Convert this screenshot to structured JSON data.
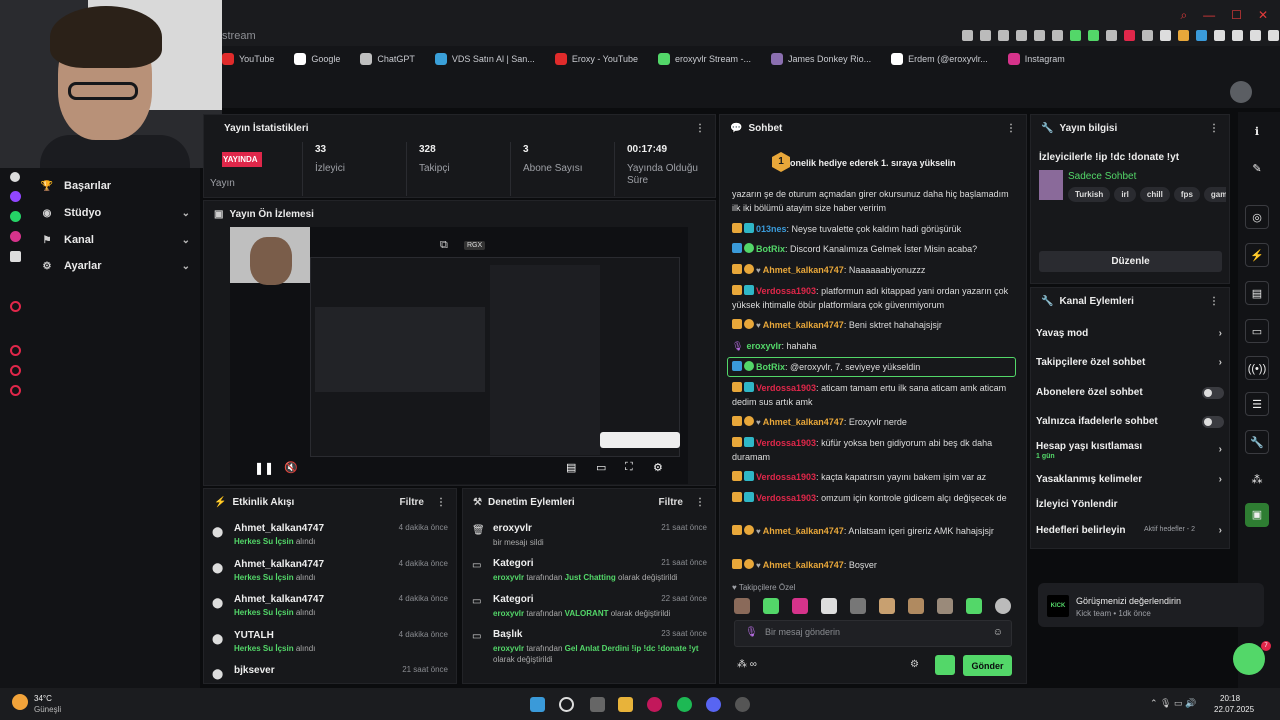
{
  "browser": {
    "tab_title": "stream",
    "bookmarks": [
      {
        "label": "YouTube",
        "color": "#e02b2b"
      },
      {
        "label": "Google",
        "color": "#ffffff"
      },
      {
        "label": "ChatGPT",
        "color": "#bfbfbf"
      },
      {
        "label": "VDS Satın Al | San...",
        "color": "#3aa0d9"
      },
      {
        "label": "Eroxy - YouTube",
        "color": "#e02b2b"
      },
      {
        "label": "eroxyvlr Stream -...",
        "color": "#53d769"
      },
      {
        "label": "James Donkey Rio...",
        "color": "#8b6fb0"
      },
      {
        "label": "Erdem (@eroxyvlr...",
        "color": "#ffffff"
      },
      {
        "label": "Instagram",
        "color": "#d6338b"
      }
    ]
  },
  "left_nav": {
    "items": [
      {
        "label": "Başarılar",
        "icon": "trophy-icon",
        "has_chevron": false
      },
      {
        "label": "Stüdyo",
        "icon": "studio-icon",
        "has_chevron": true
      },
      {
        "label": "Kanal",
        "icon": "channel-icon",
        "has_chevron": true
      },
      {
        "label": "Ayarlar",
        "icon": "gear-icon",
        "has_chevron": true
      }
    ]
  },
  "stats": {
    "title": "Yayın İstatistikleri",
    "live_badge": "YAYINDA",
    "live_label": "Yayın",
    "viewers": {
      "value": "33",
      "label": "İzleyici"
    },
    "followers": {
      "value": "328",
      "label": "Takipçi"
    },
    "subs": {
      "value": "3",
      "label": "Abone Sayısı"
    },
    "uptime": {
      "value": "00:17:49",
      "label": "Yayında Olduğu Süre"
    }
  },
  "preview": {
    "title": "Yayın Ön İzlemesi",
    "badge": "RGX"
  },
  "activity": {
    "title": "Etkinlik Akışı",
    "filter": "Filtre",
    "items": [
      {
        "name": "Ahmet_kalkan4747",
        "sub": "Herkes Su İçsin",
        "suffix": "alındı",
        "time": "4 dakika önce"
      },
      {
        "name": "Ahmet_kalkan4747",
        "sub": "Herkes Su İçsin",
        "suffix": "alındı",
        "time": "4 dakika önce"
      },
      {
        "name": "Ahmet_kalkan4747",
        "sub": "Herkes Su İçsin",
        "suffix": "alındı",
        "time": "4 dakika önce"
      },
      {
        "name": "YUTALH",
        "sub": "Herkes Su İçsin",
        "suffix": "alındı",
        "time": "4 dakika önce"
      },
      {
        "name": "bjksever",
        "sub": "",
        "suffix": "",
        "time": "21 saat önce"
      }
    ]
  },
  "moderation": {
    "title": "Denetim Eylemleri",
    "filter": "Filtre",
    "items": [
      {
        "title": "eroxyvlr",
        "line": "bir mesajı sildi",
        "time": "21 saat önce"
      },
      {
        "title": "Kategori",
        "user": "eroxyvlr",
        "pre": "tarafından",
        "target": "Just Chatting",
        "post": "olarak değiştirildi",
        "time": "21 saat önce"
      },
      {
        "title": "Kategori",
        "user": "eroxyvlr",
        "pre": "tarafından",
        "target": "VALORANT",
        "post": "olarak değiştirildi",
        "time": "22 saat önce"
      },
      {
        "title": "Başlık",
        "user": "eroxyvlr",
        "pre": "tarafından",
        "target": "Gel Anlat Derdini !ip !dc !donate !yt",
        "post": "olarak değiştirildi",
        "time": "23 saat önce"
      }
    ]
  },
  "chat": {
    "title": "Sohbet",
    "pinned": "1 abonelik hediye ederek 1. sıraya yükselin",
    "pinned_rank": "1",
    "partial_top": "yazarın şe de oturum açmadan girer okursunuz daha hiç başlamadım ilk iki bölümü atayim size haber veririm",
    "messages": [
      {
        "user": "013nes",
        "color": "#3a9ad9",
        "text": "Neyse tuvalette çok kaldım hadi görüşürük",
        "badges": "sub"
      },
      {
        "user": "BotRix",
        "color": "#53d769",
        "text": "Discord Kanalımıza Gelmek İster Misin acaba?",
        "badges": "bot"
      },
      {
        "user": "Ahmet_kalkan4747",
        "color": "#e8a73a",
        "text": "Naaaaaabiyonuzzz",
        "badges": "one"
      },
      {
        "user": "Verdossa1903",
        "color": "#e0274a",
        "text": "platformun adı kitappad yani ordan yazarın çok yüksek ihtimalle öbür platformlara çok güvenmiyorum",
        "badges": "crown"
      },
      {
        "user": "Ahmet_kalkan4747",
        "color": "#e8a73a",
        "text": "Beni sktret hahahajsjsjr",
        "badges": "one"
      },
      {
        "user": "eroxyvlr",
        "color": "#53d769",
        "text": "hahaha",
        "badges": "mic"
      },
      {
        "user": "BotRix",
        "color": "#53d769",
        "text": "@eroxyvlr, 7. seviyeye yükseldin",
        "badges": "bot"
      },
      {
        "user": "Verdossa1903",
        "color": "#e0274a",
        "text": "aticam tamam ertu ilk sana aticam amk aticam dedim sus artık amk",
        "badges": "crown"
      },
      {
        "user": "Ahmet_kalkan4747",
        "color": "#e8a73a",
        "text": "Eroxyvlr nerde",
        "badges": "one"
      },
      {
        "user": "Verdossa1903",
        "color": "#e0274a",
        "text": "küfür yoksa ben gidiyorum abi beş dk daha duramam",
        "badges": "crown"
      },
      {
        "user": "Verdossa1903",
        "color": "#e0274a",
        "text": "kaçta kapatırsın yayını bakem işim var az",
        "badges": "crown"
      },
      {
        "user": "Verdossa1903",
        "color": "#e0274a",
        "text": "omzum için kontrole gidicem alçı değişecek de",
        "badges": "crown"
      },
      {
        "user": "Ahmet_kalkan4747",
        "color": "#e8a73a",
        "text": "Anlatsam içeri gireriz AMK hahajsjsjr",
        "badges": "one"
      },
      {
        "user": "Ahmet_kalkan4747",
        "color": "#e8a73a",
        "text": "Boşver",
        "badges": "one"
      }
    ],
    "follower_only": "Takipçilere Özel",
    "input_placeholder": "Bir mesaj gönderin",
    "send": "Gönder"
  },
  "stream_info": {
    "title": "Yayın bilgisi",
    "stream_title": "İzleyicilerle !ip !dc !donate !yt",
    "category": "Sadece Sohbet",
    "tags": [
      "Turkish",
      "irl",
      "chill",
      "fps",
      "gamin"
    ],
    "edit": "Düzenle"
  },
  "channel_actions": {
    "title": "Kanal Eylemleri",
    "items": [
      {
        "label": "Yavaş mod",
        "kind": "chevron"
      },
      {
        "label": "Takipçilere özel sohbet",
        "kind": "chevron"
      },
      {
        "label": "Abonelere özel sohbet",
        "kind": "toggle"
      },
      {
        "label": "Yalnızca ifadelerle sohbet",
        "kind": "toggle"
      },
      {
        "label": "Hesap yaşı kısıtlaması",
        "kind": "chevron",
        "sub": "1 gün"
      },
      {
        "label": "Yasaklanmış kelimeler",
        "kind": "chevron"
      },
      {
        "label": "İzleyici Yönlendir",
        "kind": "none"
      },
      {
        "label": "Hedefleri belirleyin",
        "kind": "chevron",
        "extra": "Aktif hedefler - 2"
      }
    ]
  },
  "toast": {
    "logo": "KICK",
    "title": "Görüşmenizi değerlendirin",
    "sub": "Kick team • 1dk önce"
  },
  "support_badge": "7",
  "taskbar": {
    "weather_temp": "34°C",
    "weather_label": "Güneşli",
    "time": "20:18",
    "date": "22.07.2025"
  },
  "colors": {
    "accent": "#53d769",
    "live": "#e0274a",
    "panel": "#17181b"
  }
}
